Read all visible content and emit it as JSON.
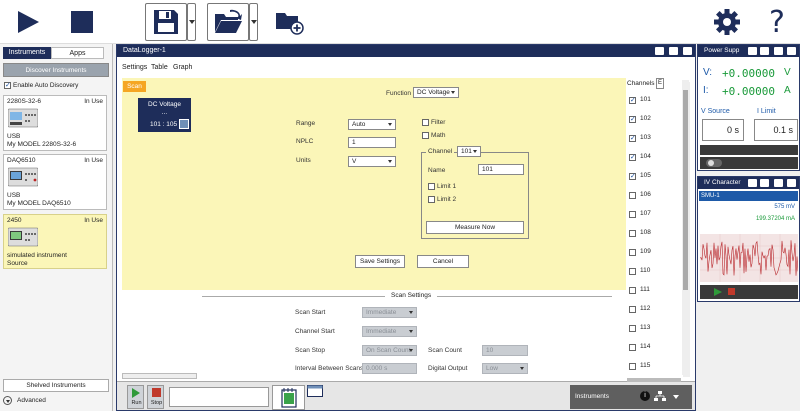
{
  "toolbar": {
    "run_icon": "play-icon",
    "stop_icon": "stop-icon",
    "save_icon": "floppy-icon",
    "open_icon": "folder-open-icon",
    "new_folder_icon": "folder-add-icon",
    "settings_icon": "gear-icon",
    "help_label": "?"
  },
  "left": {
    "tabs": [
      "Instruments",
      "Apps"
    ],
    "discover_label": "Discover Instruments",
    "auto_discovery_label": "Enable Auto Discovery",
    "instruments": [
      {
        "name": "2280S-32-6",
        "status": "In Use",
        "line1": "USB",
        "line2": "My MODEL 2280S-32-6"
      },
      {
        "name": "DAQ6510",
        "status": "In Use",
        "line1": "USB",
        "line2": "My MODEL DAQ6510"
      },
      {
        "name": "2450",
        "status": "In Use",
        "line1": "simulated instrument",
        "line2": "Source"
      }
    ],
    "shelved_label": "Shelved Instruments",
    "advanced_label": "Advanced"
  },
  "main": {
    "title": "DataLogger-1",
    "tabs": [
      "Settings",
      "Table",
      "Graph"
    ],
    "scan_tab": "Scan",
    "dc_block": {
      "title": "DC Voltage",
      "dots": "...",
      "range": "101 : 105"
    },
    "function_label": "Function",
    "function_value": "DC Voltage",
    "range_label": "Range",
    "range_value": "Auto",
    "nplc_label": "NPLC",
    "nplc_value": "1",
    "units_label": "Units",
    "units_value": "V",
    "filter_label": "Filter",
    "math_label": "Math",
    "channel_label": "Channel",
    "channel_value": "101",
    "name_label": "Name",
    "name_value": "101",
    "limit1_label": "Limit 1",
    "limit2_label": "Limit 2",
    "measure_now": "Measure Now",
    "save_settings": "Save Settings",
    "cancel": "Cancel",
    "scan_settings_title": "Scan Settings",
    "scan_start_label": "Scan Start",
    "scan_start_value": "Immediate",
    "channel_start_label": "Channel Start",
    "channel_start_value": "Immediate",
    "scan_stop_label": "Scan Stop",
    "scan_stop_value": "On Scan Count",
    "scan_count_label": "Scan Count",
    "scan_count_value": "10",
    "interval_label": "Interval Between Scans",
    "interval_value": "0.000 s",
    "digital_output_label": "Digital Output",
    "digital_output_value": "Low",
    "channels_label": "Channels",
    "channels_e": "E",
    "channels": [
      {
        "id": "101",
        "checked": true
      },
      {
        "id": "102",
        "checked": true
      },
      {
        "id": "103",
        "checked": true
      },
      {
        "id": "104",
        "checked": true
      },
      {
        "id": "105",
        "checked": true
      },
      {
        "id": "106",
        "checked": false
      },
      {
        "id": "107",
        "checked": false
      },
      {
        "id": "108",
        "checked": false
      },
      {
        "id": "109",
        "checked": false
      },
      {
        "id": "110",
        "checked": false
      },
      {
        "id": "111",
        "checked": false
      },
      {
        "id": "112",
        "checked": false
      },
      {
        "id": "113",
        "checked": false
      },
      {
        "id": "114",
        "checked": false
      },
      {
        "id": "115",
        "checked": false
      }
    ],
    "run_label": "Run",
    "stop_label": "Stop",
    "instruments_menu": "Instruments"
  },
  "power": {
    "title": "Power Supp",
    "v_label": "V:",
    "v_value": "+0.00000",
    "v_unit": "V",
    "i_label": "I:",
    "i_value": "+0.00000",
    "i_unit": "A",
    "v_source_label": "V Source",
    "i_limit_label": "I Limit",
    "v_source_value": "0 s",
    "i_limit_value": "0.1 s"
  },
  "iv": {
    "title": "IV Character",
    "smu": "SMU-1",
    "value1": "575 mV",
    "value2": "199.37204 mA"
  },
  "colors": {
    "accent": "#1e2d5a",
    "yellow": "#fbf6b8",
    "digits": "#1a9a3a",
    "scan_tab": "#f5a623"
  }
}
